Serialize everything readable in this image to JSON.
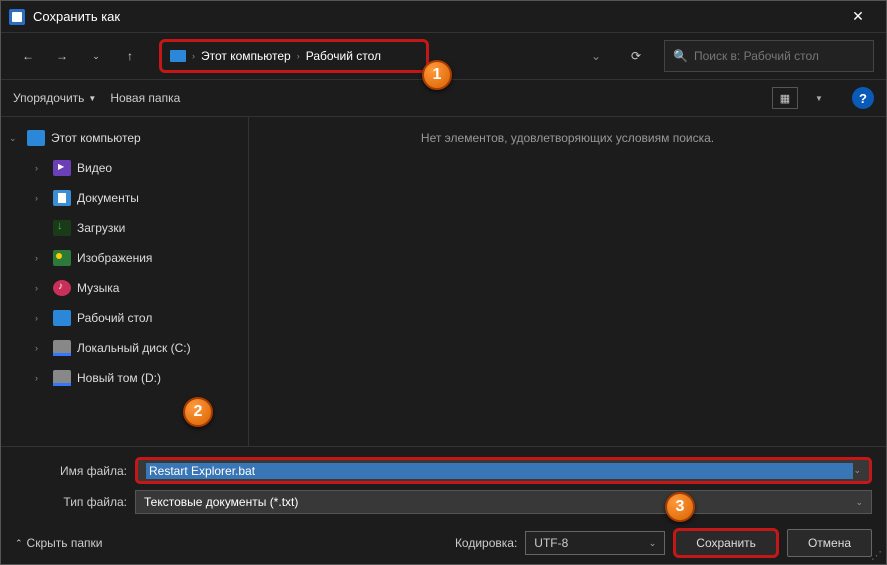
{
  "title": "Сохранить как",
  "breadcrumb": {
    "root_sep": "›",
    "pc": "Этот компьютер",
    "desktop": "Рабочий стол"
  },
  "search": {
    "placeholder": "Поиск в: Рабочий стол"
  },
  "toolbar": {
    "organize": "Упорядочить",
    "newfolder": "Новая папка"
  },
  "tree": {
    "root": "Этот компьютер",
    "items": [
      {
        "label": "Видео"
      },
      {
        "label": "Документы"
      },
      {
        "label": "Загрузки"
      },
      {
        "label": "Изображения"
      },
      {
        "label": "Музыка"
      },
      {
        "label": "Рабочий стол"
      },
      {
        "label": "Локальный диск (C:)"
      },
      {
        "label": "Новый том (D:)"
      }
    ]
  },
  "content": {
    "empty_msg": "Нет элементов, удовлетворяющих условиям поиска."
  },
  "fields": {
    "filename_label": "Имя файла:",
    "filename_value": "Restart Explorer.bat",
    "filetype_label": "Тип файла:",
    "filetype_value": "Текстовые документы (*.txt)"
  },
  "footer": {
    "hide_folders": "Скрыть папки",
    "encoding_label": "Кодировка:",
    "encoding_value": "UTF-8",
    "save": "Сохранить",
    "cancel": "Отмена"
  },
  "annotations": {
    "a1": "1",
    "a2": "2",
    "a3": "3"
  }
}
